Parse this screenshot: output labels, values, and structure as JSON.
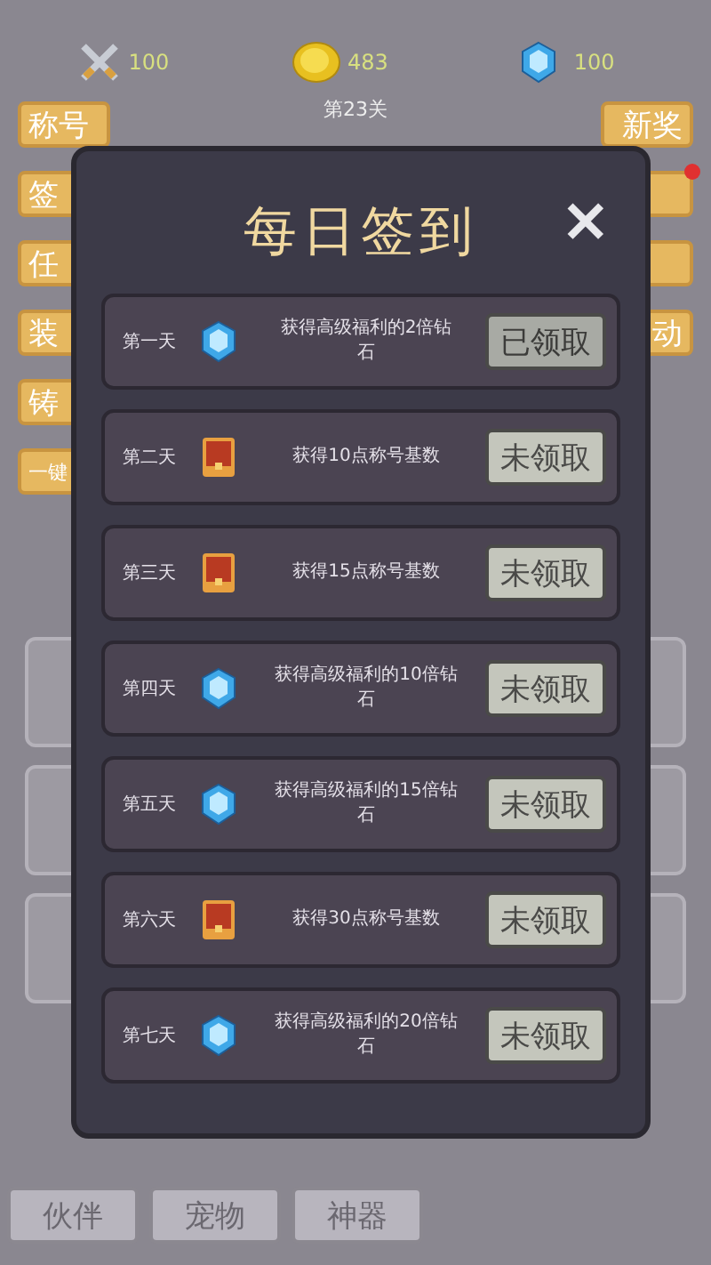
{
  "stats": [
    {
      "kind": "swords",
      "value": "100"
    },
    {
      "kind": "coin",
      "value": "483"
    },
    {
      "kind": "gem",
      "value": "100"
    }
  ],
  "level": "第23关",
  "left_buttons": [
    {
      "label": "称号"
    },
    {
      "label": "签"
    },
    {
      "label": "任"
    },
    {
      "label": "装"
    },
    {
      "label": "铸"
    },
    {
      "label": "一键"
    }
  ],
  "right_buttons": [
    {
      "label": "新奖",
      "badge": false
    },
    {
      "badge": true
    },
    {
      "badge": false
    },
    {
      "label": "动",
      "badge": false
    }
  ],
  "dialog": {
    "title": "每日签到",
    "close": "✕",
    "rows": [
      {
        "day": "第一天",
        "kind": "gem",
        "reward": "获得高级福利的2倍钻石",
        "button": "已领取",
        "claimed": true
      },
      {
        "day": "第二天",
        "kind": "chest",
        "reward": "获得10点称号基数",
        "button": "未领取",
        "claimed": false
      },
      {
        "day": "第三天",
        "kind": "chest",
        "reward": "获得15点称号基数",
        "button": "未领取",
        "claimed": false
      },
      {
        "day": "第四天",
        "kind": "gem",
        "reward": "获得高级福利的10倍钻石",
        "button": "未领取",
        "claimed": false
      },
      {
        "day": "第五天",
        "kind": "gem",
        "reward": "获得高级福利的15倍钻石",
        "button": "未领取",
        "claimed": false
      },
      {
        "day": "第六天",
        "kind": "chest",
        "reward": "获得30点称号基数",
        "button": "未领取",
        "claimed": false
      },
      {
        "day": "第七天",
        "kind": "gem",
        "reward": "获得高级福利的20倍钻石",
        "button": "未领取",
        "claimed": false
      }
    ]
  },
  "bottom_tabs": [
    {
      "label": "伙伴"
    },
    {
      "label": "宠物"
    },
    {
      "label": "神器"
    }
  ]
}
